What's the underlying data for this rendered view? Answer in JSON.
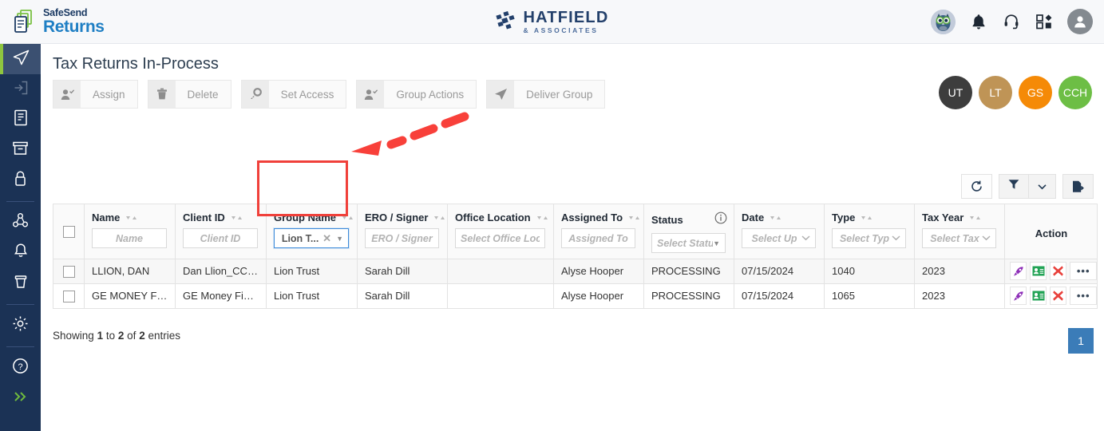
{
  "brand": {
    "top_text": "SafeSend",
    "bottom_text": "Returns",
    "logo_icon": "documents-icon"
  },
  "firm_logo": {
    "name": "HATFIELD",
    "subtitle": "& ASSOCIATES",
    "mark_icon": "hatfield-mark-icon"
  },
  "topbar": {
    "icons": [
      {
        "name": "owl-avatar-icon",
        "label": ""
      },
      {
        "name": "bell-icon",
        "label": ""
      },
      {
        "name": "headset-icon",
        "label": ""
      },
      {
        "name": "apps-grid-icon",
        "label": ""
      },
      {
        "name": "user-avatar-icon",
        "label": ""
      }
    ]
  },
  "sidebar": {
    "items": [
      {
        "name": "sidebar-item-delivered",
        "icon": "paper-plane-icon",
        "active": true
      },
      {
        "name": "sidebar-item-in-process",
        "icon": "sign-in-arrow-icon",
        "active": false
      },
      {
        "name": "sidebar-item-reports",
        "icon": "document-icon",
        "active": false
      },
      {
        "name": "sidebar-item-archive",
        "icon": "archive-box-icon",
        "active": false
      },
      {
        "name": "sidebar-item-locked",
        "icon": "lock-icon",
        "active": false
      },
      {
        "name": "sidebar-item-share",
        "icon": "share-network-icon",
        "active": false
      },
      {
        "name": "sidebar-item-notifications",
        "icon": "bell-icon",
        "active": false
      },
      {
        "name": "sidebar-item-recycle",
        "icon": "trash-icon",
        "active": false
      },
      {
        "name": "sidebar-item-settings",
        "icon": "gear-icon",
        "active": false
      },
      {
        "name": "sidebar-item-help",
        "icon": "question-circle-icon",
        "active": false
      },
      {
        "name": "sidebar-item-expand",
        "icon": "double-chevron-right-icon",
        "active": false
      }
    ]
  },
  "page": {
    "title": "Tax Returns In-Process"
  },
  "toolbar": {
    "buttons": [
      {
        "label": "Assign",
        "icon": "person-check-icon",
        "disabled": true
      },
      {
        "label": "Delete",
        "icon": "trash-icon",
        "disabled": true
      },
      {
        "label": "Set Access",
        "icon": "key-icon",
        "disabled": true
      },
      {
        "label": "Group Actions",
        "icon": "person-check-icon",
        "disabled": true
      },
      {
        "label": "Deliver Group",
        "icon": "paper-plane-icon",
        "disabled": true
      }
    ]
  },
  "group_avatars": [
    {
      "initials": "UT",
      "color": "#3d3d3d"
    },
    {
      "initials": "LT",
      "color": "#bf9456"
    },
    {
      "initials": "GS",
      "color": "#f58a07"
    },
    {
      "initials": "CCH",
      "color": "#6dbe45"
    }
  ],
  "table_controls": [
    {
      "name": "refresh-button",
      "icon": "refresh-icon"
    },
    {
      "name": "filter-button",
      "icon": "funnel-icon"
    },
    {
      "name": "filter-dropdown-button",
      "icon": "chevron-down-icon"
    },
    {
      "name": "export-button",
      "icon": "file-export-icon"
    }
  ],
  "table": {
    "columns": [
      {
        "label": "Name",
        "filter_placeholder": "Name",
        "filter_value": "",
        "sortable": true,
        "type": "text"
      },
      {
        "label": "Client ID",
        "filter_placeholder": "Client ID",
        "filter_value": "",
        "sortable": true,
        "type": "text"
      },
      {
        "label": "Group Name",
        "filter_placeholder": "",
        "filter_value": "Lion T...",
        "sortable": true,
        "type": "select",
        "selected": true,
        "highlighted": true
      },
      {
        "label": "ERO / Signer",
        "filter_placeholder": "ERO / Signer",
        "filter_value": "",
        "sortable": true,
        "type": "text"
      },
      {
        "label": "Office Location",
        "filter_placeholder": "Select Office Location",
        "filter_value": "",
        "sortable": true,
        "type": "text"
      },
      {
        "label": "Assigned To",
        "filter_placeholder": "Assigned To",
        "filter_value": "",
        "sortable": true,
        "type": "text"
      },
      {
        "label": "Status",
        "filter_placeholder": "Select Status",
        "filter_value": "",
        "sortable": false,
        "type": "select",
        "info_icon": true
      },
      {
        "label": "Date",
        "filter_placeholder": "Select Up",
        "filter_value": "",
        "sortable": true,
        "type": "select"
      },
      {
        "label": "Type",
        "filter_placeholder": "Select Typ",
        "filter_value": "",
        "sortable": true,
        "type": "select"
      },
      {
        "label": "Tax Year",
        "filter_placeholder": "Select Tax",
        "filter_value": "",
        "sortable": true,
        "type": "select"
      },
      {
        "label": "Action",
        "filter_placeholder": "",
        "filter_value": "",
        "sortable": false,
        "type": "none"
      }
    ],
    "rows": [
      {
        "name": "LLION, DAN",
        "client_id": "Dan Llion_CCH_...",
        "group_name": "Lion Trust",
        "ero_signer": "Sarah Dill",
        "office_location": "",
        "assigned_to": "Alyse Hooper",
        "status": "PROCESSING",
        "date": "07/15/2024",
        "type": "1040",
        "tax_year": "2023"
      },
      {
        "name": "GE MONEY FIN...",
        "client_id": "GE Money Finan...",
        "group_name": "Lion Trust",
        "ero_signer": "Sarah Dill",
        "office_location": "",
        "assigned_to": "Alyse Hooper",
        "status": "PROCESSING",
        "date": "07/15/2024",
        "type": "1065",
        "tax_year": "2023"
      }
    ],
    "row_actions": [
      {
        "name": "send-reminder-action",
        "icon": "rocket-icon",
        "color": "#8e2fb8"
      },
      {
        "name": "client-view-action",
        "icon": "id-card-icon",
        "color": "#22a355"
      },
      {
        "name": "delete-action",
        "icon": "red-x-icon",
        "color": "#e8413c"
      },
      {
        "name": "more-actions",
        "icon": "ellipsis-icon",
        "label": "•••"
      }
    ]
  },
  "footer": {
    "showing_prefix": "Showing",
    "from": "1",
    "to_word": "to",
    "to": "2",
    "of_word": "of",
    "total": "2",
    "entries_word": "entries",
    "page_number": "1"
  },
  "annotation": {
    "arrow_color": "#f8403a",
    "highlight_color": "#f0403a",
    "target": "group-name-filter"
  }
}
